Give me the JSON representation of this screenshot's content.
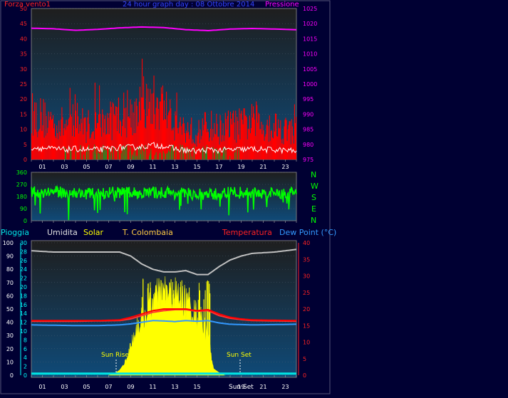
{
  "colors": {
    "background": "#000033",
    "plot_top": "#1e1e1e",
    "plot_bottom": "#0f4a78",
    "wind": "#ff0000",
    "gust_white": "#ffffff",
    "wind_green": "#228b22",
    "pressure": "#ff00ff",
    "direction": "#00ff00",
    "humidity": "#c0c0c0",
    "solar": "#ffff00",
    "colombaia": "#ff3333",
    "temperature": "#ff0000",
    "dewpoint": "#3399ff",
    "rain": "#00e5e5",
    "axis_cyan": "#00ffff"
  },
  "top_panel": {
    "title": "24 hour graph day : 08 Ottobre 2014",
    "left_label": "Forza vento1",
    "right_label": "Pressione",
    "left_ticks": [
      "0",
      "5",
      "10",
      "15",
      "20",
      "25",
      "30",
      "35",
      "40",
      "45",
      "50"
    ],
    "right_ticks": [
      "975",
      "980",
      "985",
      "990",
      "995",
      "1000",
      "1005",
      "1010",
      "1015",
      "1020",
      "1025"
    ]
  },
  "dir_panel": {
    "left_ticks": [
      "0",
      "90",
      "180",
      "270",
      "360"
    ],
    "compass": [
      "N",
      "W",
      "S",
      "E",
      "N"
    ]
  },
  "bottom_panel": {
    "legend": {
      "pioggia": "Pioggia",
      "umidita": "Umidita",
      "solar": "Solar",
      "colombaia": "T. Colombaia",
      "temperatura": "Temperatura",
      "dewpoint": "Dew Point (°C)"
    },
    "humidity_ticks": [
      "0",
      "10",
      "20",
      "30",
      "40",
      "50",
      "60",
      "70",
      "80",
      "90",
      "100"
    ],
    "rain_ticks": [
      "0",
      "2",
      "4",
      "6",
      "8",
      "10",
      "12",
      "14",
      "16",
      "18",
      "20",
      "22",
      "24",
      "26",
      "28",
      "30"
    ],
    "temp_ticks": [
      "0",
      "5",
      "10",
      "15",
      "20",
      "25",
      "30",
      "35",
      "40"
    ],
    "sun_rise": "Sun Rise",
    "sun_set": "Sun Set",
    "sun_set_axis": "Sun Set"
  },
  "x_ticks": [
    "01",
    "03",
    "05",
    "07",
    "09",
    "11",
    "13",
    "15",
    "17",
    "19",
    "21",
    "23"
  ],
  "x_ticks_bottom": [
    "01",
    "03",
    "05",
    "07",
    "09",
    "11",
    "13",
    "15",
    "17",
    "19",
    "21",
    "23"
  ],
  "chart_data": [
    {
      "type": "line",
      "title": "24 hour graph day : 08 Ottobre 2014",
      "x_unit": "hour",
      "series": [
        {
          "name": "Forza vento1",
          "axis": "left",
          "ylim": [
            0,
            50
          ],
          "x": [
            0,
            1,
            2,
            3,
            4,
            5,
            6,
            7,
            8,
            9,
            10,
            11,
            12,
            13,
            14,
            15,
            16,
            17,
            18,
            19,
            20,
            21,
            22,
            23,
            24
          ],
          "values": [
            12,
            11,
            10,
            9,
            10,
            9,
            9,
            10,
            12,
            12,
            13,
            15,
            14,
            10,
            8,
            7,
            9,
            8,
            9,
            9,
            10,
            9,
            9,
            8,
            7
          ]
        },
        {
          "name": "Pressione",
          "axis": "right",
          "ylim": [
            975,
            1025
          ],
          "x": [
            0,
            2,
            4,
            6,
            8,
            10,
            12,
            14,
            16,
            18,
            20,
            22,
            24
          ],
          "values": [
            1018.5,
            1018.3,
            1017.8,
            1018.1,
            1018.6,
            1018.9,
            1018.7,
            1018.0,
            1017.7,
            1018.2,
            1018.4,
            1018.2,
            1018.0
          ]
        }
      ]
    },
    {
      "type": "line",
      "x_unit": "hour",
      "ylim": [
        0,
        360
      ],
      "series": [
        {
          "x": [
            0,
            2,
            4,
            6,
            8,
            10,
            12,
            14,
            16,
            18,
            20,
            22,
            24
          ],
          "values": [
            210,
            215,
            205,
            200,
            210,
            205,
            210,
            200,
            190,
            210,
            205,
            200,
            210
          ]
        }
      ]
    },
    {
      "type": "line",
      "x_unit": "hour",
      "series": [
        {
          "name": "Umidita",
          "axis": "left",
          "ylim": [
            0,
            100
          ],
          "x": [
            0,
            2,
            4,
            6,
            8,
            9,
            10,
            11,
            12,
            13,
            14,
            15,
            16,
            17,
            18,
            19,
            20,
            22,
            24
          ],
          "values": [
            94,
            93,
            93,
            93,
            93,
            90,
            84,
            80,
            78,
            78,
            79,
            76,
            76,
            82,
            87,
            90,
            92,
            93,
            95
          ]
        },
        {
          "name": "Solar",
          "axis": "left",
          "ylim": [
            0,
            100
          ],
          "x": [
            7,
            7.5,
            8,
            8.5,
            9,
            9.5,
            10,
            10.5,
            11,
            11.5,
            12,
            12.5,
            13,
            13.5,
            14,
            14.5,
            15,
            15.5,
            16,
            16.5,
            17,
            17.5
          ],
          "values": [
            0,
            1,
            4,
            10,
            22,
            35,
            42,
            48,
            55,
            60,
            62,
            60,
            60,
            58,
            55,
            50,
            45,
            40,
            30,
            5,
            2,
            0
          ]
        },
        {
          "name": "Temperatura",
          "axis": "right",
          "ylim": [
            0,
            40
          ],
          "x": [
            0,
            2,
            4,
            6,
            8,
            9,
            10,
            11,
            12,
            13,
            14,
            15,
            16,
            17,
            18,
            19,
            20,
            22,
            24
          ],
          "values": [
            16.5,
            16.5,
            16.5,
            16.5,
            16.7,
            17.5,
            18.5,
            19.5,
            20,
            20,
            20,
            19.5,
            19.8,
            18.5,
            17.5,
            17,
            16.7,
            16.6,
            16.5
          ]
        },
        {
          "name": "T. Colombaia",
          "axis": "right",
          "ylim": [
            0,
            40
          ],
          "x": [
            0,
            2,
            4,
            6,
            8,
            9,
            10,
            11,
            12,
            13,
            14,
            15,
            16,
            17,
            18,
            19,
            20,
            22,
            24
          ],
          "values": [
            16.3,
            16.3,
            16.3,
            16.4,
            16.5,
            17,
            18,
            19,
            19.5,
            19.8,
            19.8,
            19.3,
            19.5,
            18,
            17.2,
            16.8,
            16.5,
            16.4,
            16.3
          ]
        },
        {
          "name": "Dew Point (°C)",
          "axis": "right",
          "ylim": [
            0,
            40
          ],
          "x": [
            0,
            2,
            4,
            6,
            8,
            9,
            10,
            11,
            12,
            13,
            14,
            15,
            16,
            17,
            18,
            19,
            20,
            22,
            24
          ],
          "values": [
            15.2,
            15.1,
            15,
            15,
            15.2,
            15.5,
            16,
            16.5,
            16.4,
            16.2,
            16.5,
            16.3,
            16.5,
            15.8,
            15.4,
            15.3,
            15.2,
            15.3,
            15.4
          ]
        },
        {
          "name": "Pioggia",
          "axis": "left2",
          "ylim": [
            0,
            30
          ],
          "x": [
            0,
            24
          ],
          "values": [
            0.2,
            0.2
          ]
        }
      ]
    }
  ]
}
